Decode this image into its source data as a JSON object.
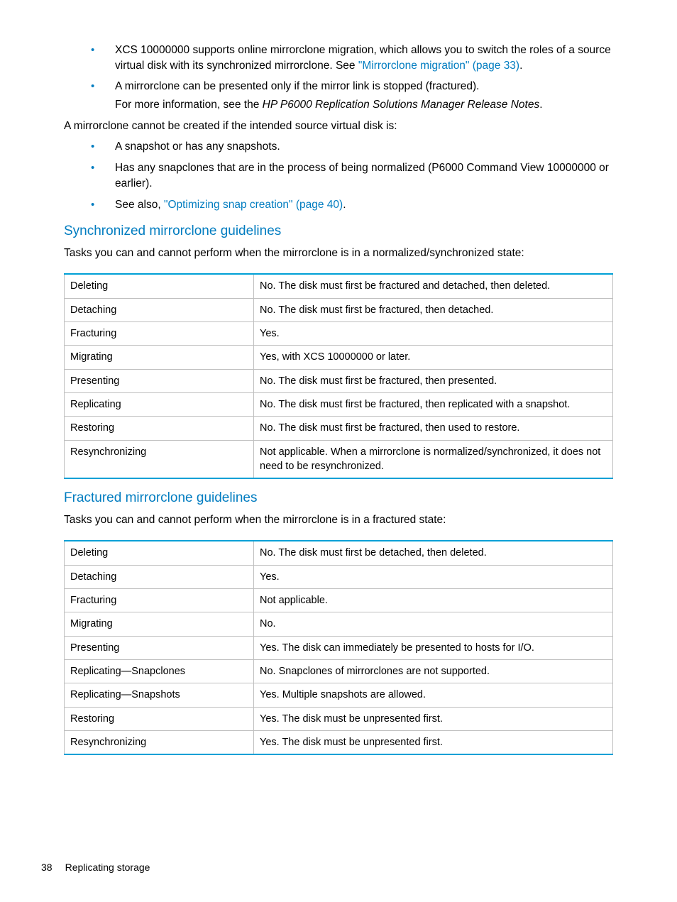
{
  "bullets_top": [
    {
      "pre": "XCS 10000000 supports online mirrorclone migration, which allows you to switch the roles of a source virtual disk with its synchronized mirrorclone. See ",
      "link": "\"Mirrorclone migration\" (page 33)",
      "post": "."
    },
    {
      "pre": "A mirrorclone can be presented only if the mirror link is stopped (fractured).",
      "link": "",
      "post": ""
    }
  ],
  "more_info_line_pre": "For more information, see the ",
  "more_info_italic": "HP P6000 Replication Solutions Manager Release Notes",
  "more_info_line_post": ".",
  "cannot_create_intro": "A mirrorclone cannot be created if the intended source virtual disk is:",
  "bullets_cannot": [
    {
      "pre": "A snapshot or has any snapshots.",
      "link": "",
      "post": ""
    },
    {
      "pre": "Has any snapclones that are in the process of being normalized (P6000 Command View 10000000 or earlier).",
      "link": "",
      "post": ""
    },
    {
      "pre": "See also, ",
      "link": "\"Optimizing snap creation\" (page 40)",
      "post": "."
    }
  ],
  "sections": {
    "sync": {
      "title": "Synchronized mirrorclone guidelines",
      "intro": "Tasks you can and cannot perform when the mirrorclone is in a normalized/synchronized state:",
      "rows": [
        {
          "task": "Deleting",
          "desc": "No. The disk must first be fractured and detached, then deleted."
        },
        {
          "task": "Detaching",
          "desc": "No. The disk must first be fractured, then detached."
        },
        {
          "task": "Fracturing",
          "desc": "Yes."
        },
        {
          "task": "Migrating",
          "desc": "Yes, with XCS 10000000 or later."
        },
        {
          "task": "Presenting",
          "desc": "No. The disk must first be fractured, then presented."
        },
        {
          "task": "Replicating",
          "desc": "No. The disk must first be fractured, then replicated with a snapshot."
        },
        {
          "task": "Restoring",
          "desc": "No. The disk must first be fractured, then used to restore."
        },
        {
          "task": "Resynchronizing",
          "desc": "Not applicable. When a mirrorclone is normalized/synchronized, it does not need to be resynchronized."
        }
      ]
    },
    "fractured": {
      "title": "Fractured mirrorclone guidelines",
      "intro": "Tasks you can and cannot perform when the mirrorclone is in a fractured state:",
      "rows": [
        {
          "task": "Deleting",
          "desc": "No. The disk must first be detached, then deleted."
        },
        {
          "task": "Detaching",
          "desc": "Yes."
        },
        {
          "task": "Fracturing",
          "desc": "Not applicable."
        },
        {
          "task": "Migrating",
          "desc": "No."
        },
        {
          "task": "Presenting",
          "desc": "Yes. The disk can immediately be presented to hosts for I/O."
        },
        {
          "task": "Replicating—Snapclones",
          "desc": "No. Snapclones of mirrorclones are not supported."
        },
        {
          "task": "Replicating—Snapshots",
          "desc": "Yes. Multiple snapshots are allowed."
        },
        {
          "task": "Restoring",
          "desc": "Yes. The disk must be unpresented first."
        },
        {
          "task": "Resynchronizing",
          "desc": "Yes. The disk must be unpresented first."
        }
      ]
    }
  },
  "footer": {
    "page": "38",
    "title": "Replicating storage"
  }
}
